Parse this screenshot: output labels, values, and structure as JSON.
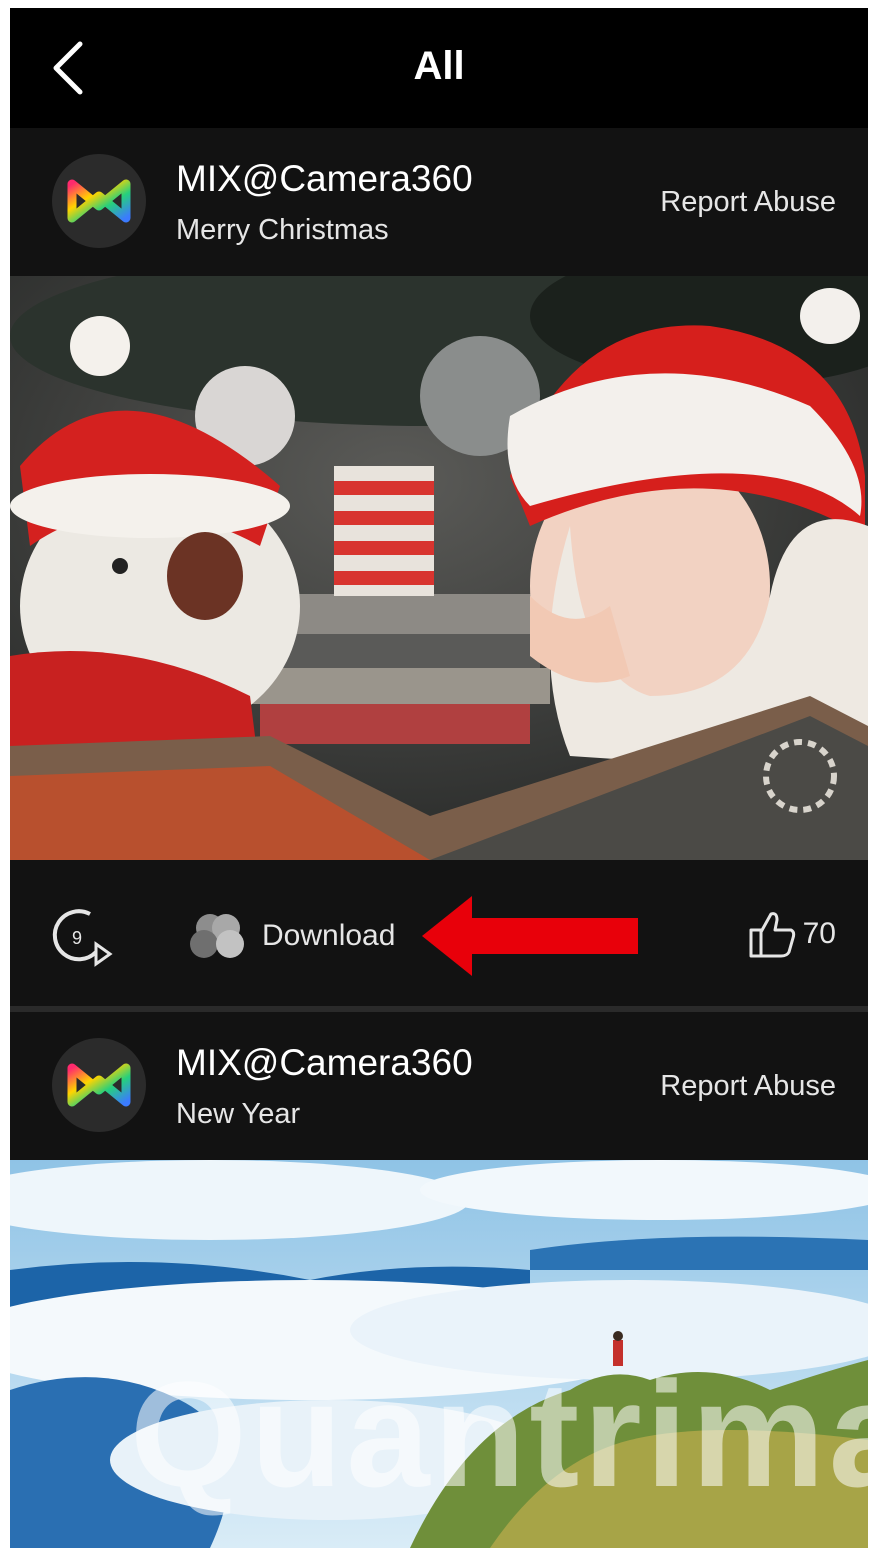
{
  "navbar": {
    "title": "All",
    "back_icon": "chevron-left-icon"
  },
  "posts": [
    {
      "author": "MIX@Camera360",
      "caption": "Merry Christmas",
      "report_label": "Report Abuse",
      "avatar_icon": "mix-logo-icon",
      "download_label": "Download",
      "likes": "70",
      "timer_icon": "timer-play-icon",
      "filter_icon": "filter-circles-icon",
      "like_icon": "thumbs-up-icon"
    },
    {
      "author": "MIX@Camera360",
      "caption": "New Year",
      "report_label": "Report Abuse",
      "avatar_icon": "mix-logo-icon"
    }
  ],
  "colors": {
    "background": "#000000",
    "card": "#121212",
    "annotation_arrow": "#e8000a",
    "text": "#e6e6e6"
  },
  "watermark": "Quantrimang"
}
